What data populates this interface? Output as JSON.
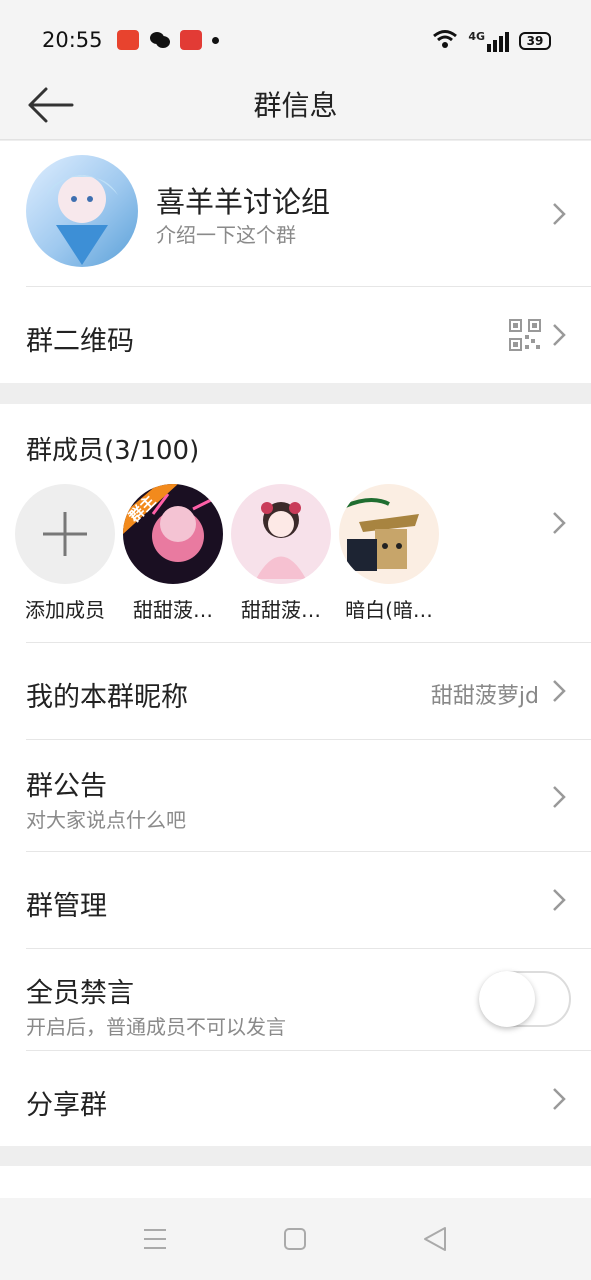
{
  "status_bar": {
    "time": "20:55",
    "network": "4G",
    "battery": "39"
  },
  "header": {
    "title": "群信息"
  },
  "group": {
    "name": "喜羊羊讨论组",
    "intro": "介绍一下这个群"
  },
  "qr_row": {
    "label": "群二维码"
  },
  "members": {
    "title": "群成员(3/100)",
    "add_label": "添加成员",
    "owner_badge": "群主",
    "items": [
      {
        "name": "甜甜菠…",
        "color": "#8a2a3a"
      },
      {
        "name": "甜甜菠…",
        "color": "#f2c7d6"
      },
      {
        "name": "暗白(暗…",
        "color": "#c7a56a"
      }
    ]
  },
  "nickname_row": {
    "label": "我的本群昵称",
    "value": "甜甜菠萝jd"
  },
  "notice_row": {
    "label": "群公告",
    "sub": "对大家说点什么吧"
  },
  "manage_row": {
    "label": "群管理"
  },
  "mute_row": {
    "label": "全员禁言",
    "sub": "开启后，普通成员不可以发言",
    "enabled": false
  },
  "share_row": {
    "label": "分享群"
  },
  "nav": {
    "items": [
      "menu-icon",
      "home-icon",
      "back-icon"
    ]
  }
}
